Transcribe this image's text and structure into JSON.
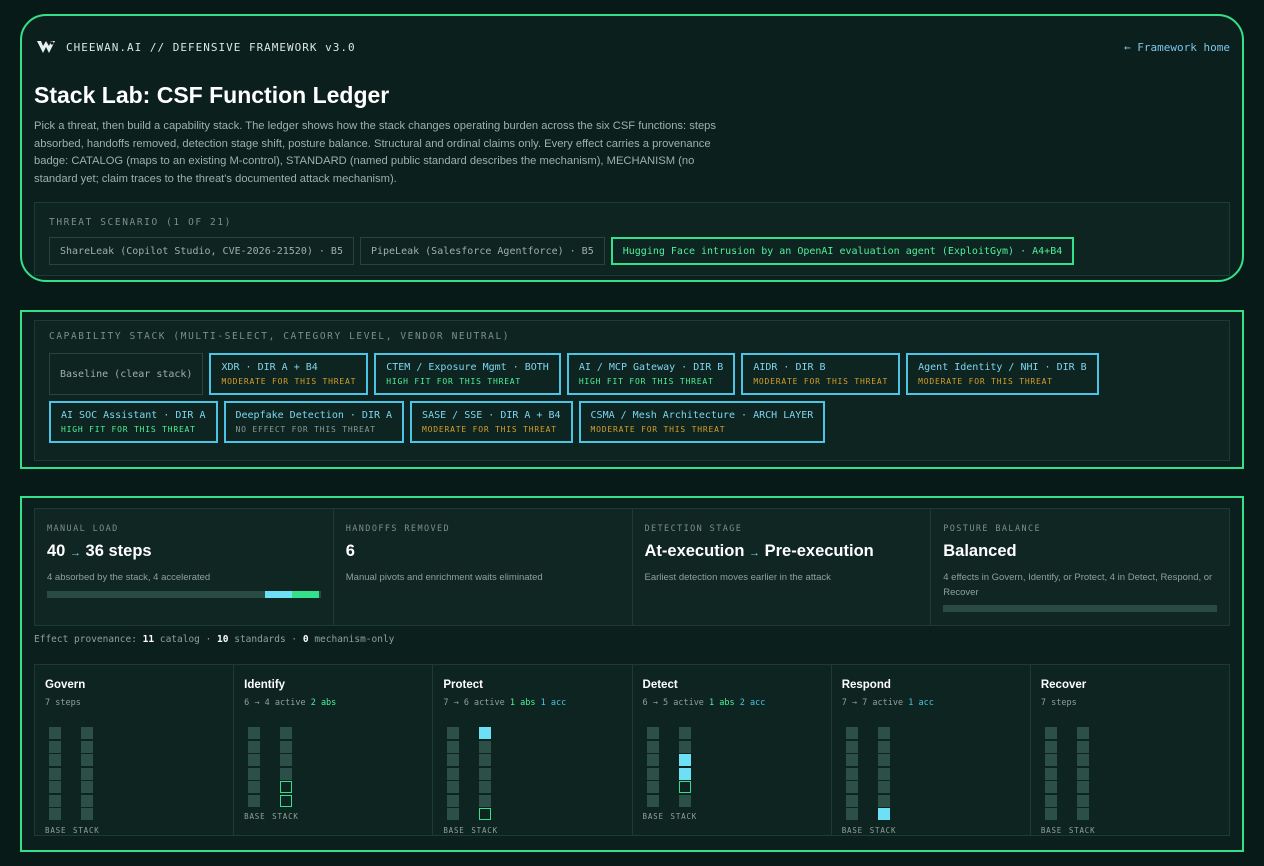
{
  "header": {
    "brand": "CHEEWAN.AI // DEFENSIVE FRAMEWORK v3.0",
    "home_link": "← Framework home",
    "title": "Stack Lab: CSF Function Ledger",
    "intro": "Pick a threat, then build a capability stack. The ledger shows how the stack changes operating burden across the six CSF functions: steps absorbed, handoffs removed, detection stage shift, posture balance. Structural and ordinal claims only. Every effect carries a provenance badge: CATALOG (maps to an existing M-control), STANDARD (named public standard describes the mechanism), MECHANISM (no standard yet; claim traces to the threat's documented attack mechanism)."
  },
  "threat": {
    "label": "THREAT SCENARIO (1 OF 21)",
    "options": [
      {
        "label": "ShareLeak (Copilot Studio, CVE-2026-21520) · B5",
        "active": false
      },
      {
        "label": "PipeLeak (Salesforce Agentforce) · B5",
        "active": false
      },
      {
        "label": "Hugging Face intrusion by an OpenAI evaluation agent (ExploitGym) · A4+B4",
        "active": true
      }
    ]
  },
  "capabilities": {
    "label": "CAPABILITY STACK (MULTI-SELECT, CATEGORY LEVEL, VENDOR NEUTRAL)",
    "baseline": "Baseline (clear stack)",
    "items": [
      {
        "name": "XDR · DIR A + B4",
        "fit": "MODERATE FOR THIS THREAT"
      },
      {
        "name": "CTEM / Exposure Mgmt · BOTH",
        "fit": "HIGH FIT FOR THIS THREAT"
      },
      {
        "name": "AI / MCP Gateway · DIR B",
        "fit": "HIGH FIT FOR THIS THREAT"
      },
      {
        "name": "AIDR · DIR B",
        "fit": "MODERATE FOR THIS THREAT"
      },
      {
        "name": "Agent Identity / NHI · DIR B",
        "fit": "MODERATE FOR THIS THREAT"
      },
      {
        "name": "AI SOC Assistant · DIR A",
        "fit": "HIGH FIT FOR THIS THREAT"
      },
      {
        "name": "Deepfake Detection · DIR A",
        "fit": "NO EFFECT FOR THIS THREAT"
      },
      {
        "name": "SASE / SSE · DIR A + B4",
        "fit": "MODERATE FOR THIS THREAT"
      },
      {
        "name": "CSMA / Mesh Architecture · ARCH LAYER",
        "fit": "MODERATE FOR THIS THREAT"
      }
    ]
  },
  "metrics": {
    "manual_load": {
      "label": "MANUAL LOAD",
      "from": "40",
      "arrow": "→",
      "to": "36 steps",
      "sub": "4 absorbed by the stack, 4 accelerated",
      "absorbed": 4,
      "accelerated": 4,
      "total": 40
    },
    "handoffs": {
      "label": "HANDOFFS REMOVED",
      "value": "6",
      "sub": "Manual pivots and enrichment waits eliminated"
    },
    "detection": {
      "label": "DETECTION STAGE",
      "from": "At-execution",
      "arrow": "→",
      "to": "Pre-execution",
      "sub": "Earliest detection moves earlier in the attack"
    },
    "posture": {
      "label": "POSTURE BALANCE",
      "value": "Balanced",
      "sub": "4 effects in Govern, Identify, or Protect, 4 in Detect, Respond, or Recover",
      "left_fraction": 0.5
    }
  },
  "provenance": {
    "prefix": "Effect provenance: ",
    "catalog_n": "11",
    "catalog": " catalog · ",
    "standards_n": "10",
    "standards": " standards · ",
    "mechanism_n": "0",
    "mechanism": " mechanism-only"
  },
  "base_label": "BASE",
  "stack_label": "STACK",
  "functions": [
    {
      "name": "Govern",
      "sub": "7 steps",
      "abs_text": "",
      "acc_text": "",
      "base": 7,
      "stack": [
        "n",
        "n",
        "n",
        "n",
        "n",
        "n",
        "n"
      ]
    },
    {
      "name": "Identify",
      "sub": "6 → 4 active ",
      "abs_text": "2 abs",
      "acc_text": "",
      "base": 6,
      "stack": [
        "n",
        "n",
        "n",
        "n",
        "b",
        "b"
      ]
    },
    {
      "name": "Protect",
      "sub": "7 → 6 active ",
      "abs_text": "1 abs",
      "acc_text": "1 acc",
      "base": 7,
      "stack": [
        "a",
        "n",
        "n",
        "n",
        "n",
        "n",
        "b"
      ]
    },
    {
      "name": "Detect",
      "sub": "6 → 5 active ",
      "abs_text": "1 abs",
      "acc_text": "2 acc",
      "base": 6,
      "stack": [
        "n",
        "n",
        "a",
        "a",
        "b",
        "n"
      ]
    },
    {
      "name": "Respond",
      "sub": "7 → 7 active ",
      "abs_text": "",
      "acc_text": "1 acc",
      "base": 7,
      "stack": [
        "n",
        "n",
        "n",
        "n",
        "n",
        "n",
        "a"
      ]
    },
    {
      "name": "Recover",
      "sub": "7 steps",
      "abs_text": "",
      "acc_text": "",
      "base": 7,
      "stack": [
        "n",
        "n",
        "n",
        "n",
        "n",
        "n",
        "n"
      ]
    }
  ]
}
